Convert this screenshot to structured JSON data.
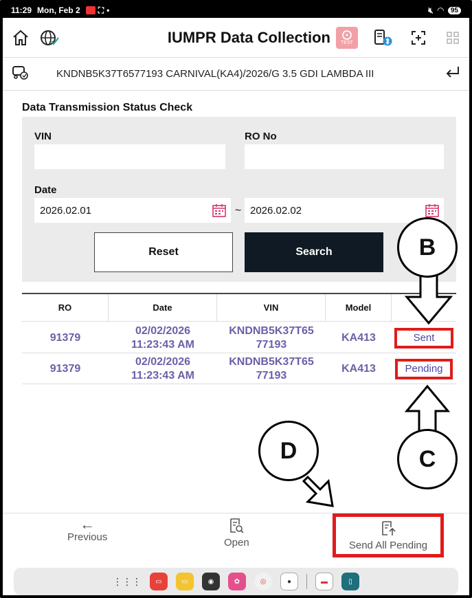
{
  "status_bar": {
    "time": "11:29",
    "date": "Mon, Feb 2",
    "battery": "95"
  },
  "header": {
    "title": "IUMPR Data Collection",
    "test_badge": "TEST"
  },
  "vehicle": {
    "info": "KNDNB5K37T6577193 CARNIVAL(KA4)/2026/G 3.5 GDI LAMBDA III"
  },
  "section_title": "Data Transmission Status Check",
  "filters": {
    "vin_label": "VIN",
    "vin_value": "",
    "ro_label": "RO No",
    "ro_value": "",
    "date_label": "Date",
    "date_from": "2026.02.01",
    "date_to": "2026.02.02",
    "range_separator": "~",
    "reset_label": "Reset",
    "search_label": "Search"
  },
  "table": {
    "columns": [
      "RO",
      "Date",
      "VIN",
      "Model",
      ""
    ],
    "rows": [
      {
        "ro": "91379",
        "date": "02/02/2026",
        "time": "11:23:43 AM",
        "vin_1": "KNDNB5K37T65",
        "vin_2": "77193",
        "model": "KA413",
        "status": "Sent"
      },
      {
        "ro": "91379",
        "date": "02/02/2026",
        "time": "11:23:43 AM",
        "vin_1": "KNDNB5K37T65",
        "vin_2": "77193",
        "model": "KA413",
        "status": "Pending"
      }
    ]
  },
  "callouts": {
    "b": "B",
    "c": "C",
    "d": "D"
  },
  "bottom_bar": {
    "previous": "Previous",
    "open": "Open",
    "send_all": "Send All Pending"
  },
  "colors": {
    "highlight": "#e01b1b",
    "link": "#6a60a8",
    "search_button": "#0f1a24"
  }
}
